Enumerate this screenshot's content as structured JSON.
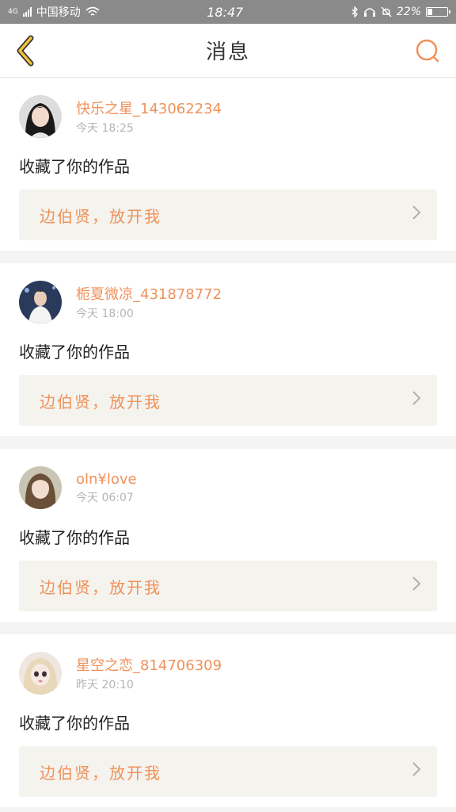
{
  "status_bar": {
    "carrier": "中国移动",
    "network": "4G",
    "time": "18:47",
    "battery": "22%",
    "icons": [
      "wifi-icon",
      "bluetooth-icon",
      "headset-icon",
      "mute-icon",
      "battery-icon"
    ]
  },
  "header": {
    "title": "消息",
    "back_icon": "chevron-left-icon",
    "search_icon": "search-icon",
    "accent_color": "#f0915a"
  },
  "messages": [
    {
      "username": "快乐之星_143062234",
      "time": "今天 18:25",
      "action": "收藏了你的作品",
      "work_title": "边伯贤，放开我",
      "avatar": "avatar-girl-dark-hair"
    },
    {
      "username": "栀夏微凉_431878772",
      "time": "今天 18:00",
      "action": "收藏了你的作品",
      "work_title": "边伯贤，放开我",
      "avatar": "avatar-man-white-suit"
    },
    {
      "username": "oln¥love",
      "time": "今天 06:07",
      "action": "收藏了你的作品",
      "work_title": "边伯贤，放开我",
      "avatar": "avatar-girl-brown-hair"
    },
    {
      "username": "星空之恋_814706309",
      "time": "昨天 20:10",
      "action": "收藏了你的作品",
      "work_title": "边伯贤，放开我",
      "avatar": "avatar-doll"
    }
  ]
}
